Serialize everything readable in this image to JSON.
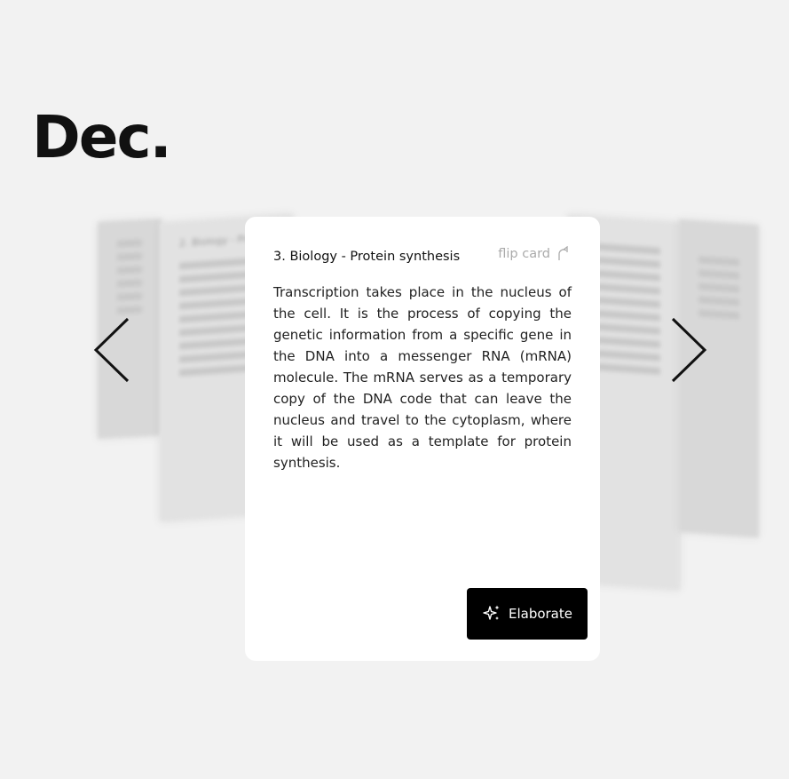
{
  "brand": {
    "logo_text": "Dec."
  },
  "card": {
    "title": "3. Biology - Protein synthesis",
    "flip_label": "flip card",
    "body": "Transcription takes place in the nucleus of the cell. It is the process of copying the genetic information from a specific gene in the DNA into a messenger RNA (mRNA) molecule. The mRNA serves as a temporary copy of the DNA code that can leave the nucleus and travel to the cytoplasm, where it will be used as a template for protein synthesis.",
    "elaborate_label": "Elaborate"
  },
  "ghost_cards": {
    "left_title": "2. Biology - Protein synthesis"
  },
  "navigation": {
    "prev_icon": "chevron-left-icon",
    "next_icon": "chevron-right-icon"
  },
  "colors": {
    "background": "#f2f2f2",
    "card": "#ffffff",
    "button": "#000000",
    "muted": "#aaaaaa"
  }
}
